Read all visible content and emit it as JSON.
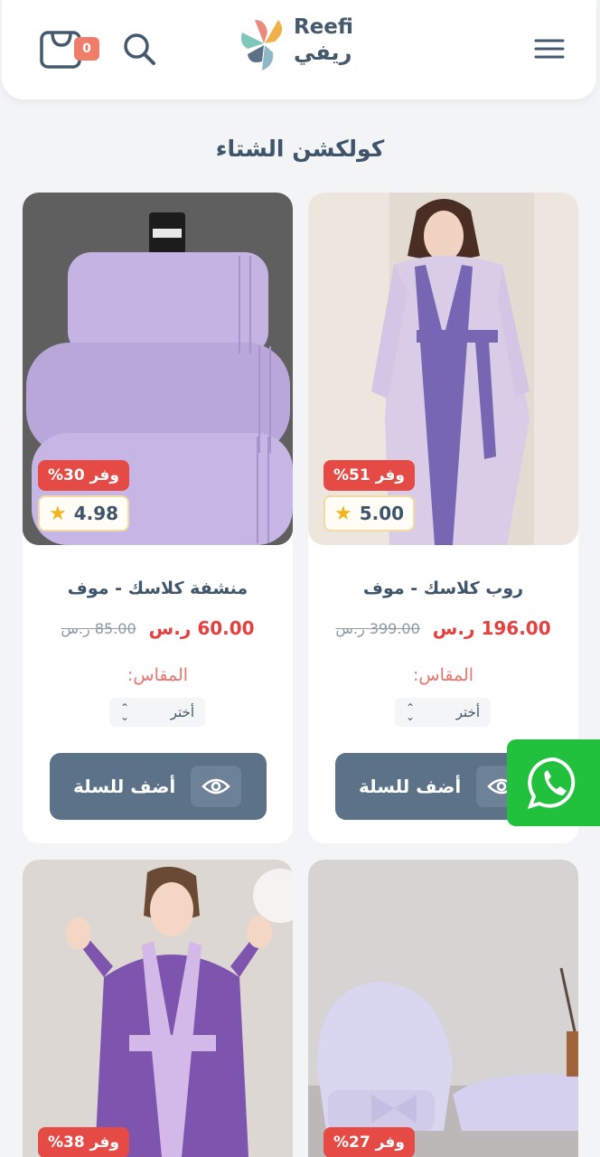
{
  "header": {
    "cart_count": "0",
    "logo_en": "Reefi",
    "logo_ar": "ريفي"
  },
  "section_title": "كولكشن الشتاء",
  "products": [
    {
      "name": "منشفة كلاسك - موف",
      "discount": "وفر 30%",
      "rating": "4.98",
      "price_new": "60.00 ر.س",
      "price_old": "85.00 ر.س",
      "size_label": "المقاس:",
      "size_select": "أختر",
      "add_label": "أضف للسلة"
    },
    {
      "name": "روب كلاسك - موف",
      "discount": "وفر 51%",
      "rating": "5.00",
      "price_new": "196.00 ر.س",
      "price_old": "399.00 ر.س",
      "size_label": "المقاس:",
      "size_select": "أختر",
      "add_label": "أضف للسلة"
    },
    {
      "discount": "وفر 38%"
    },
    {
      "discount": "وفر 27%"
    }
  ],
  "colors": {
    "accent": "#e64a45",
    "button": "#5b7288",
    "whatsapp": "#21c13d"
  }
}
